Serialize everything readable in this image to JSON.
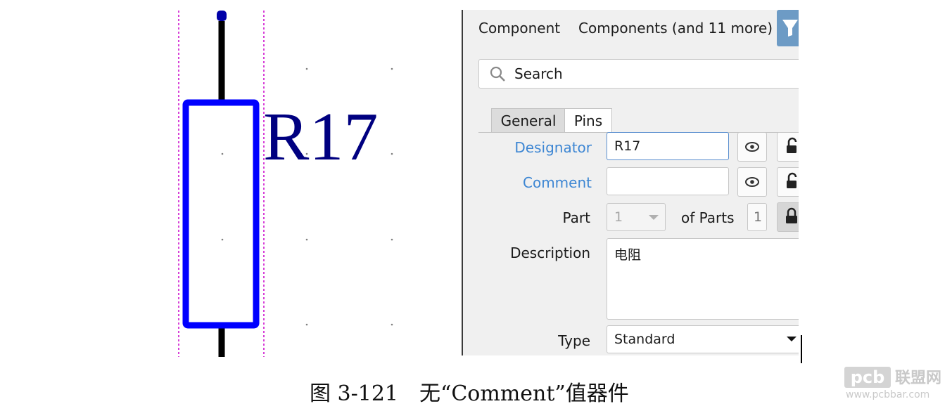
{
  "schematic": {
    "designator_label": "R17",
    "colors": {
      "body": "#0000ff",
      "wire": "#000000",
      "text": "#000080",
      "guide": "#cc00cc",
      "grid": "#808080"
    }
  },
  "panel": {
    "header": {
      "kind": "Component",
      "selection": "Components (and 11 more)"
    },
    "search": {
      "placeholder": "Search"
    },
    "tabs": [
      {
        "label": "General"
      },
      {
        "label": "Pins"
      }
    ],
    "properties": {
      "designator": {
        "label": "Designator",
        "value": "R17"
      },
      "comment": {
        "label": "Comment",
        "value": ""
      },
      "part": {
        "label": "Part",
        "value": "1",
        "of_label": "of Parts",
        "of_value": "1"
      },
      "description": {
        "label": "Description",
        "value": "电阻"
      },
      "type": {
        "label": "Type",
        "value": "Standard"
      }
    },
    "icons": {
      "search": "search-icon",
      "eye": "eye-icon",
      "lock": "lock-icon",
      "dropdown": "chevron-down-icon",
      "filter": "filter-icon"
    },
    "colors": {
      "link_label": "#3d86d3",
      "accent": "#6d9bc5",
      "focus_border": "#5b8fcf"
    }
  },
  "caption": "图 3-121　无“Comment”值器件",
  "watermark": {
    "brand": "pcb",
    "site_cn": "联盟网",
    "url": "www.pcbbar.com"
  }
}
